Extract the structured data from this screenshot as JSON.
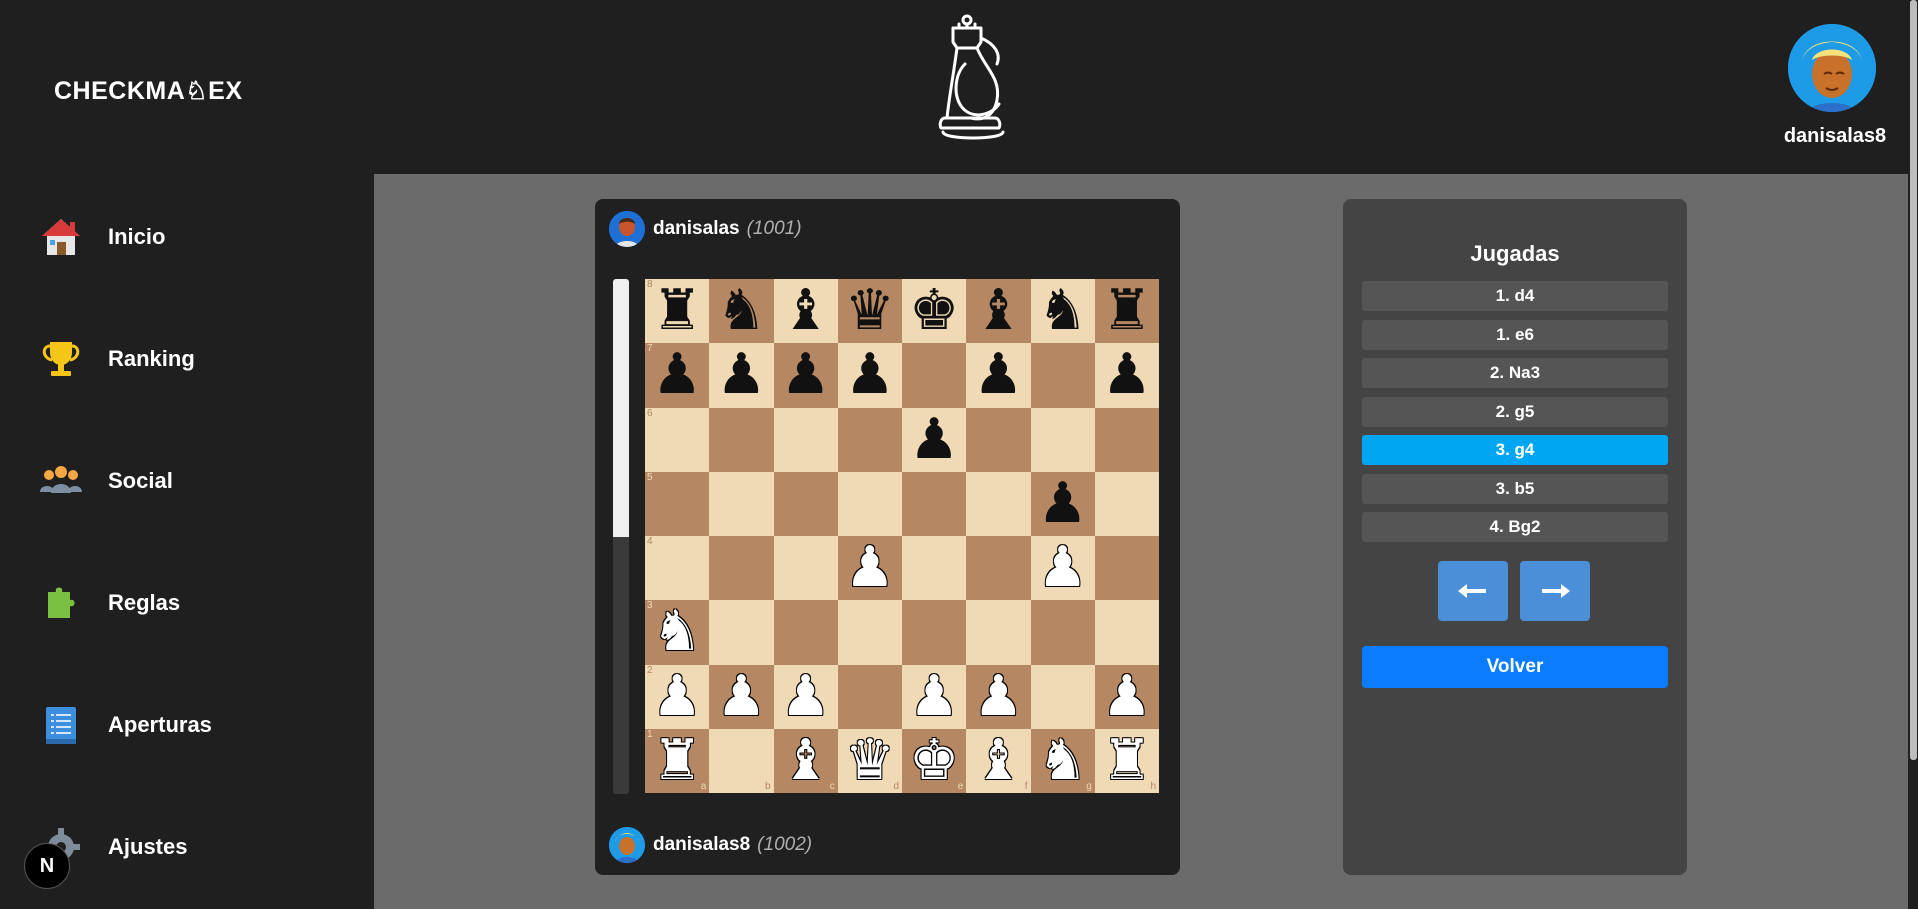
{
  "app": {
    "logo_text": "CHECKMA♘EX",
    "user": {
      "name": "danisalas8"
    }
  },
  "sidebar": {
    "items": [
      {
        "label": "Inicio",
        "icon": "house-icon"
      },
      {
        "label": "Ranking",
        "icon": "trophy-icon"
      },
      {
        "label": "Social",
        "icon": "people-icon"
      },
      {
        "label": "Reglas",
        "icon": "puzzle-icon"
      },
      {
        "label": "Aperturas",
        "icon": "book-icon"
      },
      {
        "label": "Ajustes",
        "icon": "gear-icon"
      }
    ],
    "badge": "N"
  },
  "game": {
    "top_player": {
      "name": "danisalas",
      "elo": "(1001)"
    },
    "bottom_player": {
      "name": "danisalas8",
      "elo": "(1002)"
    },
    "eval_white_fraction": 0.5,
    "board": [
      [
        "bR",
        "bN",
        "bB",
        "bQ",
        "bK",
        "bB",
        "bN",
        "bR"
      ],
      [
        "bP",
        "bP",
        "bP",
        "bP",
        "",
        "bP",
        "",
        "bP"
      ],
      [
        "",
        "",
        "",
        "",
        "bP",
        "",
        "",
        ""
      ],
      [
        "",
        "",
        "",
        "",
        "",
        "",
        "bP",
        ""
      ],
      [
        "",
        "",
        "",
        "wP",
        "",
        "",
        "wP",
        ""
      ],
      [
        "wN",
        "",
        "",
        "",
        "",
        "",
        "",
        ""
      ],
      [
        "wP",
        "wP",
        "wP",
        "",
        "wP",
        "wP",
        "",
        "wP"
      ],
      [
        "wR",
        "",
        "wB",
        "wQ",
        "wK",
        "wB",
        "wN",
        "wR"
      ]
    ],
    "ranks": [
      "8",
      "7",
      "6",
      "5",
      "4",
      "3",
      "2",
      "1"
    ],
    "files": [
      "a",
      "b",
      "c",
      "d",
      "e",
      "f",
      "g",
      "h"
    ]
  },
  "moves_panel": {
    "title": "Jugadas",
    "moves": [
      "1. d4",
      "1. e6",
      "2. Na3",
      "2. g5",
      "3. g4",
      "3. b5",
      "4. Bg2"
    ],
    "active_index": 4,
    "prev_icon": "arrow-left-icon",
    "next_icon": "arrow-right-icon",
    "back_label": "Volver"
  }
}
